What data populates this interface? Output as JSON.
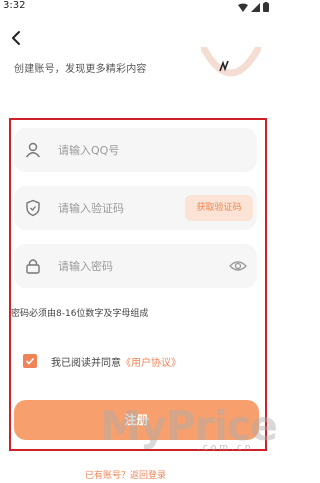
{
  "status": {
    "time": "3:32"
  },
  "header": {
    "subtitle": "创建账号，发现更多精彩内容"
  },
  "form": {
    "qq_placeholder": "请输入QQ号",
    "code_placeholder": "请输入验证码",
    "get_code_label": "获取验证码",
    "password_placeholder": "请输入密码",
    "password_hint": "密码必须由8-16位数字及字母组成"
  },
  "agreement": {
    "checked": true,
    "text": "我已阅读并同意",
    "link": "《用户协议》"
  },
  "register_label": "注册",
  "login": {
    "question": "已有账号？",
    "link": "返回登录"
  },
  "watermark": {
    "brand": "MyPrice",
    "domain": ".com.cn"
  },
  "colors": {
    "accent": "#f08458",
    "button": "#f7a06e",
    "highlight_border": "#d02027"
  }
}
